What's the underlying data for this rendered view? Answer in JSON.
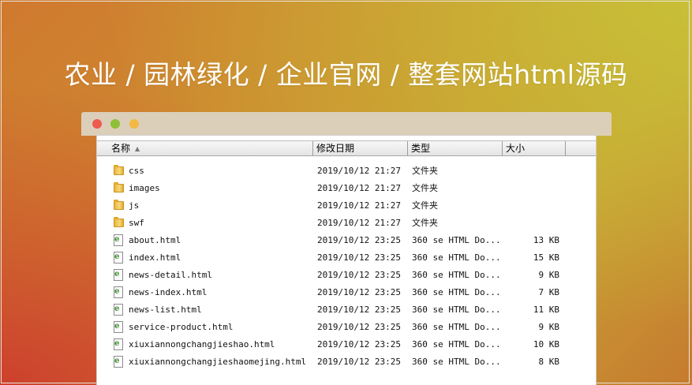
{
  "banner": {
    "title": "农业 / 园林绿化 / 企业官网 / 整套网站html源码"
  },
  "window": {
    "controls": [
      "close",
      "minimize",
      "maximize"
    ]
  },
  "explorer": {
    "columns": {
      "name": "名称",
      "date": "修改日期",
      "type": "类型",
      "size": "大小"
    },
    "sort_indicator": "▲",
    "rows": [
      {
        "icon": "folder-icon",
        "name": "css",
        "date": "2019/10/12 21:27",
        "type": "文件夹",
        "size": ""
      },
      {
        "icon": "folder-icon",
        "name": "images",
        "date": "2019/10/12 21:27",
        "type": "文件夹",
        "size": ""
      },
      {
        "icon": "folder-icon",
        "name": "js",
        "date": "2019/10/12 21:27",
        "type": "文件夹",
        "size": ""
      },
      {
        "icon": "folder-icon",
        "name": "swf",
        "date": "2019/10/12 21:27",
        "type": "文件夹",
        "size": ""
      },
      {
        "icon": "html-file-icon",
        "name": "about.html",
        "date": "2019/10/12 23:25",
        "type": "360 se HTML Do...",
        "size": "13 KB"
      },
      {
        "icon": "html-file-icon",
        "name": "index.html",
        "date": "2019/10/12 23:25",
        "type": "360 se HTML Do...",
        "size": "15 KB"
      },
      {
        "icon": "html-file-icon",
        "name": "news-detail.html",
        "date": "2019/10/12 23:25",
        "type": "360 se HTML Do...",
        "size": "9 KB"
      },
      {
        "icon": "html-file-icon",
        "name": "news-index.html",
        "date": "2019/10/12 23:25",
        "type": "360 se HTML Do...",
        "size": "7 KB"
      },
      {
        "icon": "html-file-icon",
        "name": "news-list.html",
        "date": "2019/10/12 23:25",
        "type": "360 se HTML Do...",
        "size": "11 KB"
      },
      {
        "icon": "html-file-icon",
        "name": "service-product.html",
        "date": "2019/10/12 23:25",
        "type": "360 se HTML Do...",
        "size": "9 KB"
      },
      {
        "icon": "html-file-icon",
        "name": "xiuxiannongchangjieshao.html",
        "date": "2019/10/12 23:25",
        "type": "360 se HTML Do...",
        "size": "10 KB"
      },
      {
        "icon": "html-file-icon",
        "name": "xiuxiannongchangjieshaomejing.html",
        "date": "2019/10/12 23:25",
        "type": "360 se HTML Do...",
        "size": "8 KB"
      }
    ]
  },
  "colors": {
    "close": "#ee5a50",
    "minimize": "#8fbf36",
    "maximize": "#f2b945",
    "title_bar": "#dccfb9"
  }
}
